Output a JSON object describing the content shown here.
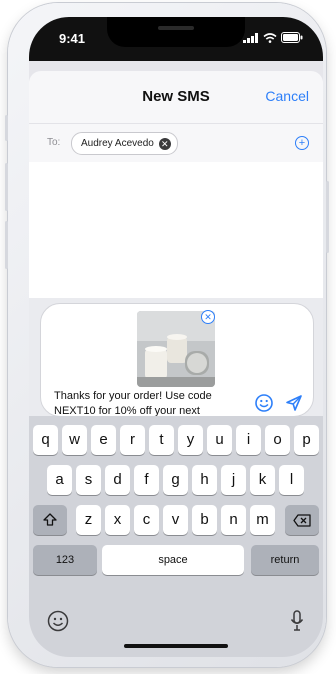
{
  "status_bar": {
    "time": "9:41"
  },
  "header": {
    "title": "New SMS",
    "cancel_label": "Cancel"
  },
  "recipients": {
    "to_label": "To:",
    "chips": [
      {
        "name": "Audrey Acevedo"
      }
    ]
  },
  "compose": {
    "message_lines": [
      "Thanks for your order! Use code",
      "NEXT10 for 10% off your next"
    ]
  },
  "keyboard": {
    "row1": [
      "q",
      "w",
      "e",
      "r",
      "t",
      "y",
      "u",
      "i",
      "o",
      "p"
    ],
    "row2": [
      "a",
      "s",
      "d",
      "f",
      "g",
      "h",
      "j",
      "k",
      "l"
    ],
    "row3": [
      "z",
      "x",
      "c",
      "v",
      "b",
      "n",
      "m"
    ],
    "numbers_label": "123",
    "space_label": "space",
    "return_label": "return"
  },
  "colors": {
    "accent": "#2d7ff9",
    "keyboard_bg": "#d1d3d9"
  },
  "icons": [
    "chip-remove-icon",
    "add-contact-icon",
    "attachment-remove-icon",
    "emoji-icon",
    "send-icon",
    "shift-icon",
    "backspace-icon",
    "keyboard-emoji-icon",
    "microphone-icon"
  ]
}
